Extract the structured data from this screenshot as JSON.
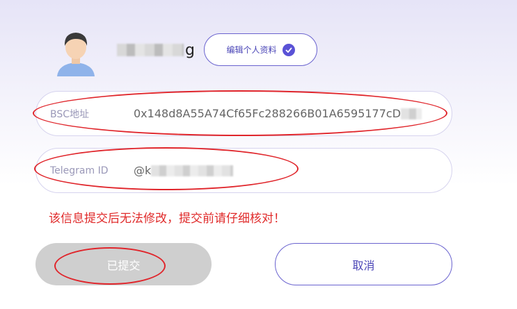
{
  "profile": {
    "username_visible": "g",
    "edit_button_label": "编辑个人资料"
  },
  "fields": {
    "bsc": {
      "label": "BSC地址",
      "value": "0x148d8A55A74Cf65Fc288266B01A6595177cD"
    },
    "telegram": {
      "label": "Telegram ID",
      "value": "@k"
    }
  },
  "warning": "该信息提交后无法修改，提交前请仔细核对！",
  "buttons": {
    "submitted_label": "已提交",
    "cancel_label": "取消"
  },
  "colors": {
    "accent": "#5a52d6",
    "warning": "#e02b2b",
    "disabled": "#cfcfcf",
    "annotation": "#e0252b"
  }
}
